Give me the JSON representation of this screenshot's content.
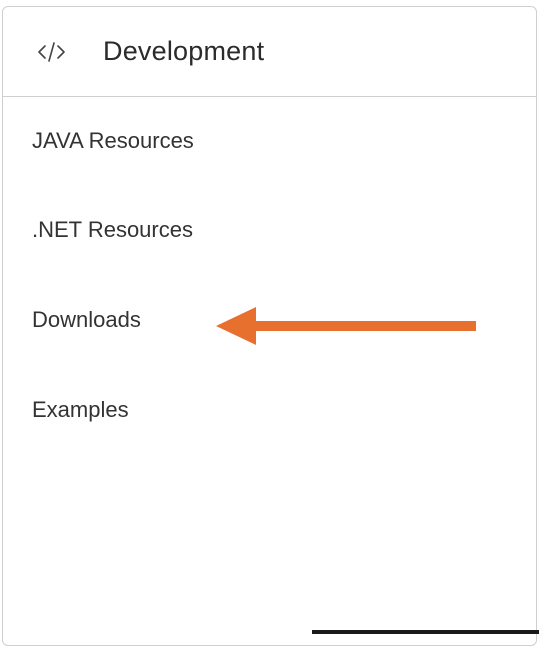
{
  "panel": {
    "title": "Development",
    "icon": "code-icon"
  },
  "menu": {
    "items": [
      {
        "label": "JAVA Resources"
      },
      {
        "label": ".NET Resources"
      },
      {
        "label": "Downloads"
      },
      {
        "label": "Examples"
      }
    ]
  },
  "annotation": {
    "arrow_color": "#e8702f",
    "target": "Downloads"
  }
}
